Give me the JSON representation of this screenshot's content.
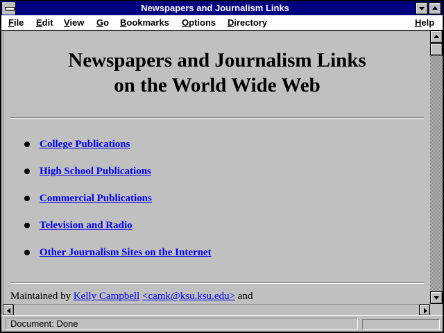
{
  "window": {
    "title": "Newspapers and Journalism Links"
  },
  "menubar": {
    "items": [
      "File",
      "Edit",
      "View",
      "Go",
      "Bookmarks",
      "Options",
      "Directory"
    ],
    "help": "Help"
  },
  "page": {
    "heading_line1": "Newspapers and Journalism Links",
    "heading_line2": "on the World Wide Web",
    "links": [
      "College Publications",
      "High School Publications",
      "Commercial Publications",
      "Television and Radio",
      "Other Journalism Sites on the Internet"
    ],
    "footer": {
      "prefix": "Maintained by",
      "name_link": "Kelly Campbell",
      "email_link": "<camk@ksu.ksu.edu>",
      "suffix": "and"
    }
  },
  "status": {
    "text": "Document: Done"
  },
  "colors": {
    "title_bar": "#000080",
    "link": "#0000ee",
    "window_bg": "#c0c0c0"
  },
  "icons": [
    "system-menu-icon",
    "minimize-icon",
    "maximize-icon",
    "scroll-up-icon",
    "scroll-down-icon",
    "scroll-left-icon",
    "scroll-right-icon",
    "bullet-icon"
  ]
}
